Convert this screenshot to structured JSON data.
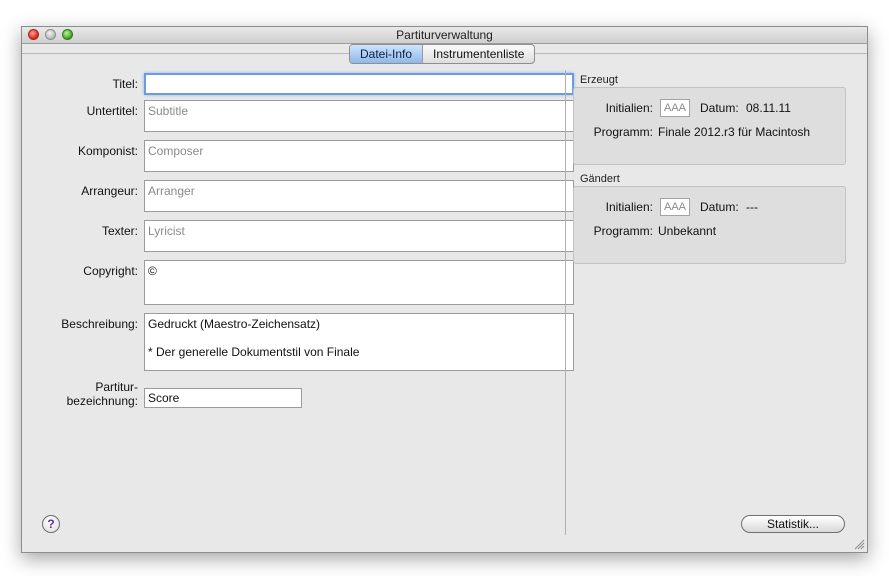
{
  "window": {
    "title": "Partiturverwaltung"
  },
  "tabs": [
    {
      "label": "Datei-Info",
      "active": true
    },
    {
      "label": "Instrumentenliste",
      "active": false
    }
  ],
  "form": {
    "title": {
      "label": "Titel:",
      "value": ""
    },
    "subtitle": {
      "label": "Untertitel:",
      "placeholder": "Subtitle"
    },
    "composer": {
      "label": "Komponist:",
      "placeholder": "Composer"
    },
    "arranger": {
      "label": "Arrangeur:",
      "placeholder": "Arranger"
    },
    "lyricist": {
      "label": "Texter:",
      "placeholder": "Lyricist"
    },
    "copyright": {
      "label": "Copyright:",
      "value": "©"
    },
    "description": {
      "label": "Beschreibung:",
      "value": "Gedruckt (Maestro-Zeichensatz)\n\n* Der generelle Dokumentstil von Finale"
    },
    "score_name": {
      "label_line1": "Partitur-",
      "label_line2": "bezeichnung:",
      "value": "Score"
    }
  },
  "created": {
    "heading": "Erzeugt",
    "initials_label": "Initialien:",
    "initials_placeholder": "AAA",
    "date_label": "Datum:",
    "date_value": "08.11.11",
    "program_label": "Programm:",
    "program_value": "Finale 2012.r3 für Macintosh"
  },
  "modified": {
    "heading": "Gändert",
    "initials_label": "Initialien:",
    "initials_placeholder": "AAA",
    "date_label": "Datum:",
    "date_value": "---",
    "program_label": "Programm:",
    "program_value": "Unbekannt"
  },
  "buttons": {
    "statistics": "Statistik...",
    "help": "?"
  },
  "colors": {
    "accent": "#8fb8ea",
    "focus_ring": "#6d9be0"
  }
}
